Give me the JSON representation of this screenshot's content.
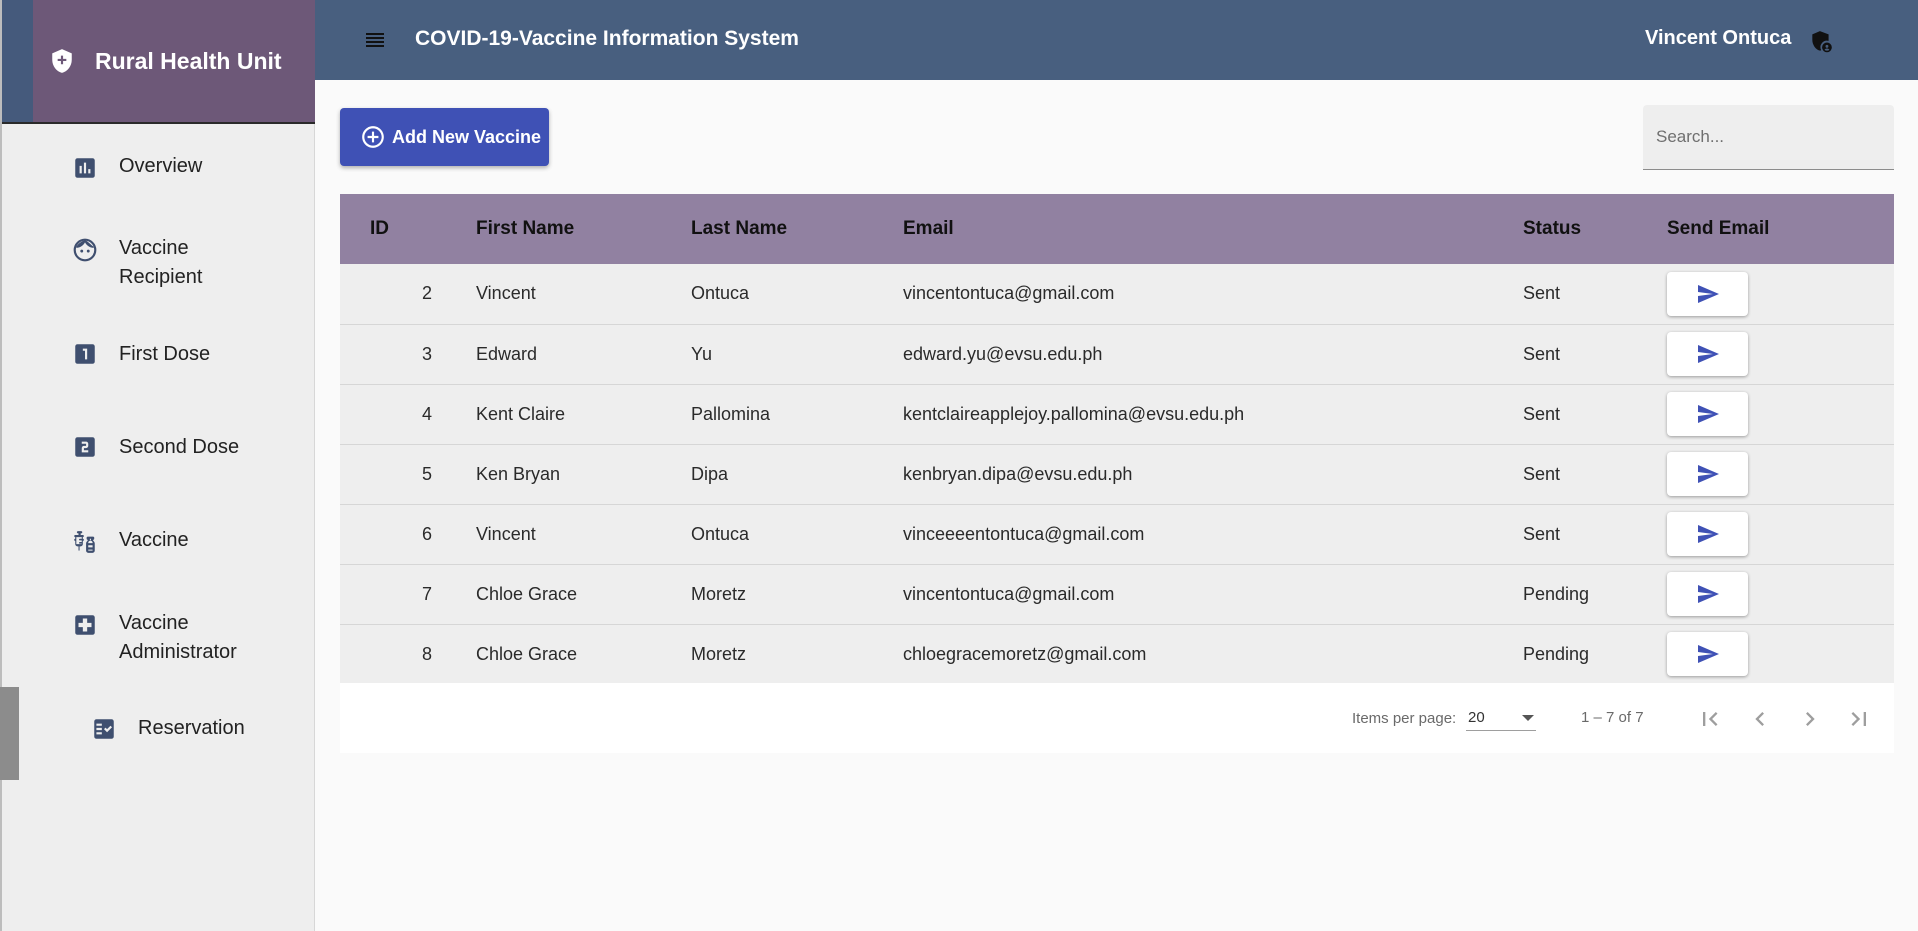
{
  "sidebar": {
    "brand_title": "Rural Health Unit",
    "items": [
      {
        "label": "Overview",
        "icon": "chart-icon"
      },
      {
        "label": "Vaccine\nRecipient",
        "icon": "face-icon"
      },
      {
        "label": "First Dose",
        "icon": "looks-one-icon"
      },
      {
        "label": "Second Dose",
        "icon": "looks-two-icon"
      },
      {
        "label": "Vaccine",
        "icon": "vaccines-icon"
      },
      {
        "label": "Vaccine\nAdministrator",
        "icon": "medical-cross-icon"
      },
      {
        "label": "Reservation",
        "icon": "checklist-icon"
      }
    ]
  },
  "header": {
    "title": "COVID-19-Vaccine Information System",
    "user_name": "Vincent Ontuca"
  },
  "toolbar": {
    "add_label": "Add New Vaccine",
    "search_placeholder": "Search..."
  },
  "table": {
    "columns": [
      "ID",
      "First Name",
      "Last Name",
      "Email",
      "Status",
      "Send Email"
    ],
    "rows": [
      {
        "id": "2",
        "first": "Vincent",
        "last": "Ontuca",
        "email": "vincentontuca@gmail.com",
        "status": "Sent"
      },
      {
        "id": "3",
        "first": "Edward",
        "last": "Yu",
        "email": "edward.yu@evsu.edu.ph",
        "status": "Sent"
      },
      {
        "id": "4",
        "first": "Kent Claire",
        "last": "Pallomina",
        "email": "kentclaireapplejoy.pallomina@evsu.edu.ph",
        "status": "Sent"
      },
      {
        "id": "5",
        "first": "Ken Bryan",
        "last": "Dipa",
        "email": "kenbryan.dipa@evsu.edu.ph",
        "status": "Sent"
      },
      {
        "id": "6",
        "first": "Vincent",
        "last": "Ontuca",
        "email": "vinceeeentontuca@gmail.com",
        "status": "Sent"
      },
      {
        "id": "7",
        "first": "Chloe Grace",
        "last": "Moretz",
        "email": "vincentontuca@gmail.com",
        "status": "Pending"
      },
      {
        "id": "8",
        "first": "Chloe Grace",
        "last": "Moretz",
        "email": "chloegracemoretz@gmail.com",
        "status": "Pending"
      }
    ]
  },
  "paginator": {
    "items_per_page_label": "Items per page:",
    "page_size": "20",
    "range_label": "1 – 7 of 7"
  },
  "colors": {
    "header": "#485f7f",
    "brand": "#6d5878",
    "table_header": "#9181a1",
    "accent": "#3f51b5"
  }
}
